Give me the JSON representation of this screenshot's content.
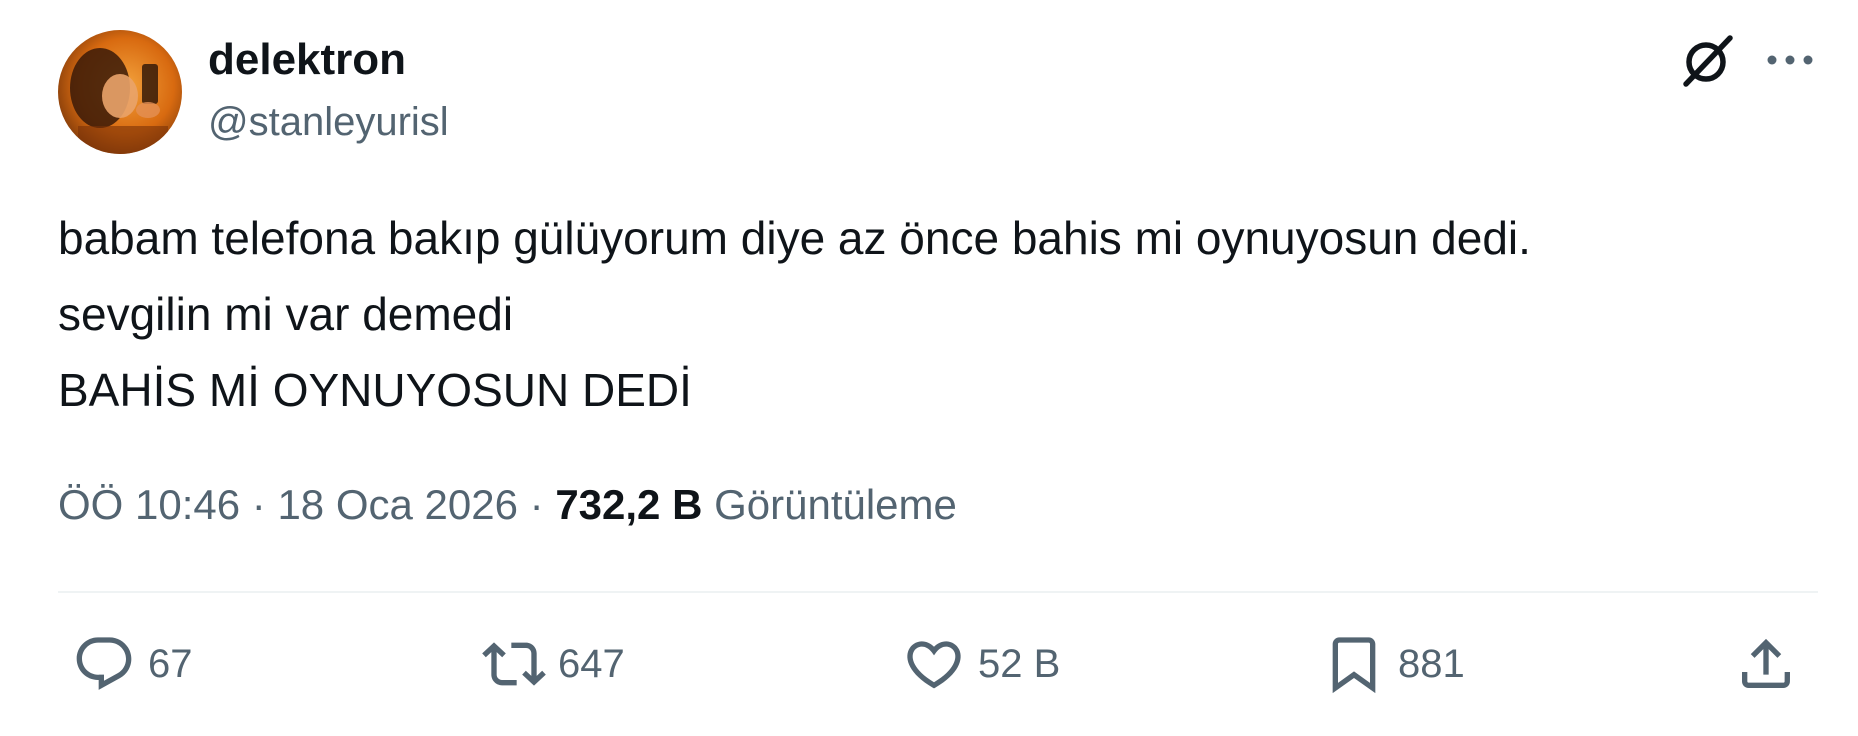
{
  "author": {
    "display_name": "delektron",
    "handle": "@stanleyurisl"
  },
  "tweet": {
    "lines": [
      "babam telefona bakıp gülüyorum diye az önce bahis mi oynuyosun dedi.",
      "sevgilin mi var demedi",
      "BAHİS Mİ OYNUYOSUN DEDİ"
    ]
  },
  "meta": {
    "time": "ÖÖ 10:46",
    "separator": "·",
    "date": "18 Oca 2026",
    "views_count": "732,2 B",
    "views_label": "Görüntüleme"
  },
  "actions": {
    "reply_count": "67",
    "retweet_count": "647",
    "like_count": "52 B",
    "bookmark_count": "881"
  },
  "icons": {
    "grok": "grok-icon",
    "more": "more-icon",
    "reply": "reply-icon",
    "retweet": "retweet-icon",
    "like": "heart-icon",
    "bookmark": "bookmark-icon",
    "share": "share-icon"
  },
  "colors": {
    "text_primary": "#0f1419",
    "text_secondary": "#536471",
    "divider": "#eff3f4",
    "avatar_warm": "#d86a10"
  }
}
